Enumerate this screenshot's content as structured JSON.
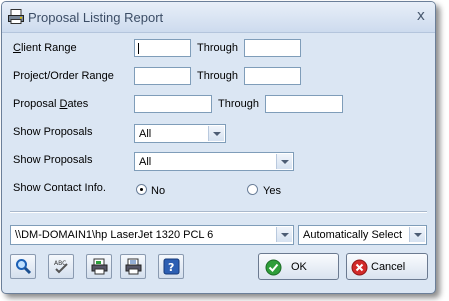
{
  "window": {
    "title": "Proposal Listing Report",
    "close_glyph": "x"
  },
  "form": {
    "client_range": {
      "label_pre": "",
      "label_underline": "C",
      "label_post": "lient Range",
      "through": "Through"
    },
    "project_range": {
      "label": "Project/Order Range",
      "through": "Through"
    },
    "proposal_dates": {
      "label_pre": "Proposal ",
      "label_underline": "D",
      "label_post": "ates",
      "through": "Through"
    },
    "show_proposals_1": {
      "label": "Show Proposals",
      "value": "All"
    },
    "show_proposals_2": {
      "label": "Show Proposals",
      "value": "All"
    },
    "contact_info": {
      "label": "Show Contact Info.",
      "option_no": "No",
      "option_yes": "Yes"
    }
  },
  "printer": {
    "value": "\\\\DM-DOMAIN1\\hp LaserJet 1320 PCL 6",
    "tray": "Automatically Select"
  },
  "buttons": {
    "ok": "OK",
    "cancel": "Cancel"
  },
  "icons": {
    "title": "report-icon",
    "preview": "magnifier-icon",
    "spell": "spellcheck-icon",
    "export": "export-icon",
    "print": "printer-icon",
    "help": "help-icon"
  }
}
